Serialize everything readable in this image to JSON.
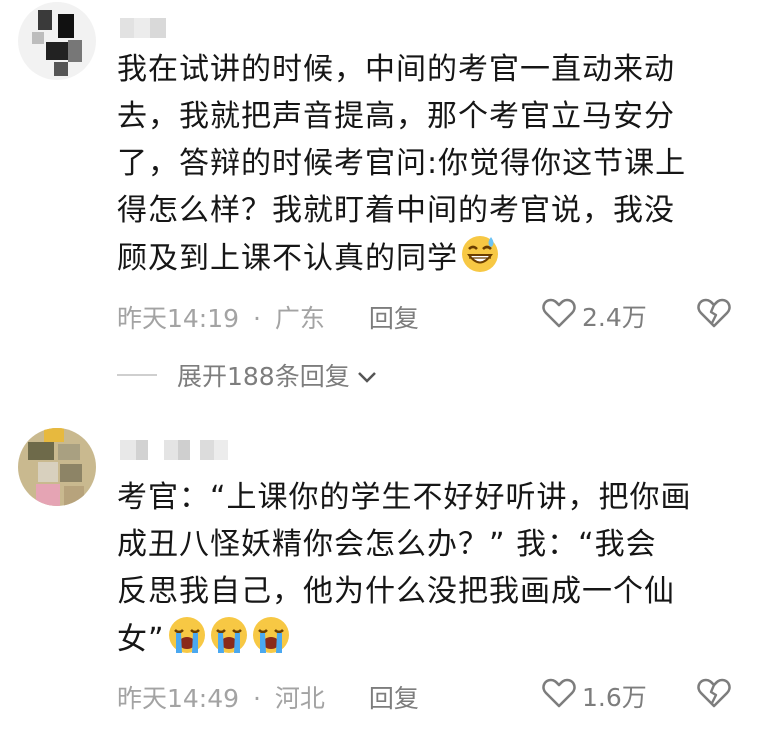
{
  "comments": [
    {
      "lines": [
        "我在试讲的时候，中间的考官一直动来动",
        "去，我就把声音提高，那个考官立马安分",
        "了，答辩的时候考官问:你觉得你这节课上",
        "得怎么样？我就盯着中间的考官说，我没",
        "顾及到上课不认真的同学"
      ],
      "emoji": [
        "grinning-sweat-emoji"
      ],
      "time": "昨天14:19",
      "separator": "·",
      "location": "广东",
      "reply_label": "回复",
      "likes": "2.4万"
    },
    {
      "lines": [
        "考官：“上课你的学生不好好听讲，把你画",
        "成丑八怪妖精你会怎么办？” 我：“我会",
        "反思我自己，他为什么没把我画成一个仙",
        "女”"
      ],
      "emoji": [
        "crying-face-emoji",
        "crying-face-emoji",
        "crying-face-emoji"
      ],
      "time": "昨天14:49",
      "separator": "·",
      "location": "河北",
      "reply_label": "回复",
      "likes": "1.6万"
    }
  ],
  "expand_replies": {
    "label": "展开188条回复"
  },
  "colors": {
    "text": "#161616",
    "meta": "#a3a3a3",
    "action": "#7d7d7d"
  }
}
